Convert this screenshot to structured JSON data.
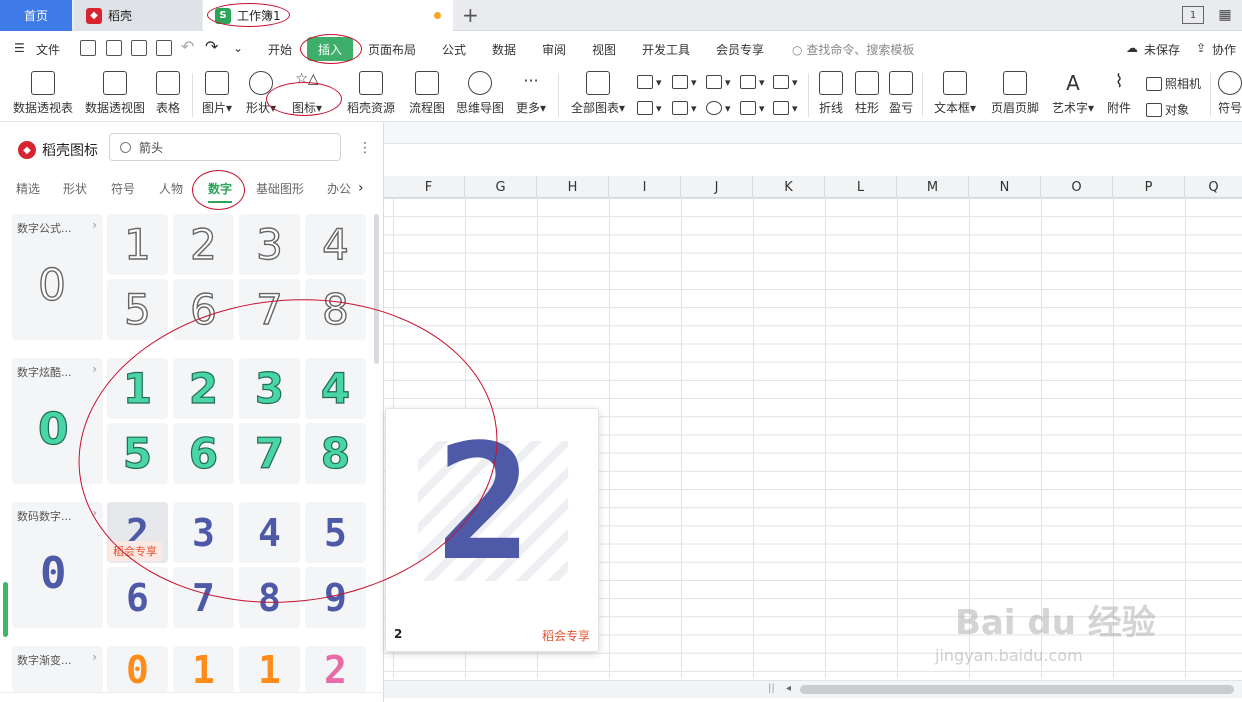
{
  "tabs": {
    "home": "首页",
    "docer": "稻壳",
    "workbook": "工作簿1",
    "workbook_icon": "S"
  },
  "menu": {
    "file": "文件",
    "items": [
      "开始",
      "插入",
      "页面布局",
      "公式",
      "数据",
      "审阅",
      "视图",
      "开发工具",
      "会员专享"
    ],
    "search_placeholder": "查找命令、搜索模板",
    "unsaved": "未保存",
    "collab": "协作"
  },
  "ribbon": {
    "pivot_table": "数据透视表",
    "pivot_chart": "数据透视图",
    "table": "表格",
    "picture": "图片",
    "shape": "形状",
    "icon": "图标",
    "docer_res": "稻壳资源",
    "flowchart": "流程图",
    "mindmap": "思维导图",
    "more": "更多",
    "all_charts": "全部图表",
    "line": "折线",
    "column": "柱形",
    "winloss": "盈亏",
    "textbox": "文本框",
    "header_footer": "页眉页脚",
    "wordart": "艺术字",
    "attachment": "附件",
    "camera": "照相机",
    "object": "对象",
    "symbol": "符号"
  },
  "panel": {
    "title": "稻壳图标",
    "search_value": "箭头",
    "categories": [
      "精选",
      "形状",
      "符号",
      "人物",
      "数字",
      "基础图形",
      "办公"
    ],
    "groups": [
      {
        "label": "数字公式...",
        "zero": "0",
        "digits": [
          "1",
          "2",
          "3",
          "4",
          "5",
          "6",
          "7",
          "8"
        ]
      },
      {
        "label": "数字炫酷...",
        "zero": "0",
        "digits": [
          "1",
          "2",
          "3",
          "4",
          "5",
          "6",
          "7",
          "8"
        ]
      },
      {
        "label": "数码数字...",
        "zero": "0",
        "digits": [
          "2",
          "3",
          "4",
          "5",
          "6",
          "7",
          "8",
          "9"
        ]
      },
      {
        "label": "数字渐变...",
        "digits": [
          "0",
          "1",
          "1",
          "2"
        ]
      }
    ],
    "vip_badge": "稻会专享"
  },
  "sheet": {
    "columns": [
      "F",
      "G",
      "H",
      "I",
      "J",
      "K",
      "L",
      "M",
      "N",
      "O",
      "P",
      "Q"
    ]
  },
  "preview": {
    "glyph": "2",
    "name": "2",
    "vip": "稻会专享"
  },
  "watermark": {
    "brand": "Bai du 经验",
    "url": "jingyan.baidu.com"
  }
}
